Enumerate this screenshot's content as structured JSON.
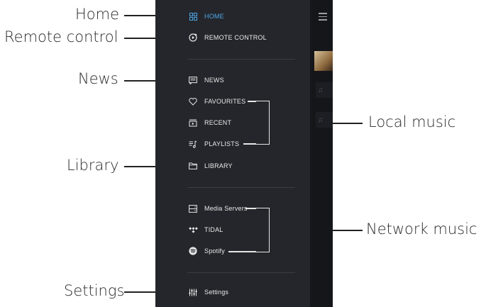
{
  "callouts": {
    "home": "Home",
    "remote_control": "Remote control",
    "news": "News",
    "library": "Library",
    "settings": "Settings",
    "local_music": "Local music",
    "network_music": "Network music"
  },
  "menu": {
    "home": "HOME",
    "remote_control": "REMOTE CONTROL",
    "news": "NEWS",
    "favourites": "FAVOURITES",
    "recent": "RECENT",
    "playlists": "PLAYLISTS",
    "library": "LIBRARY",
    "media_servers": "Media Servers",
    "tidal": "TIDAL",
    "spotify": "Spotify",
    "settings": "Settings"
  },
  "colors": {
    "drawer_bg": "#25262b",
    "active": "#4da6e8",
    "text": "#e8e8ea"
  }
}
